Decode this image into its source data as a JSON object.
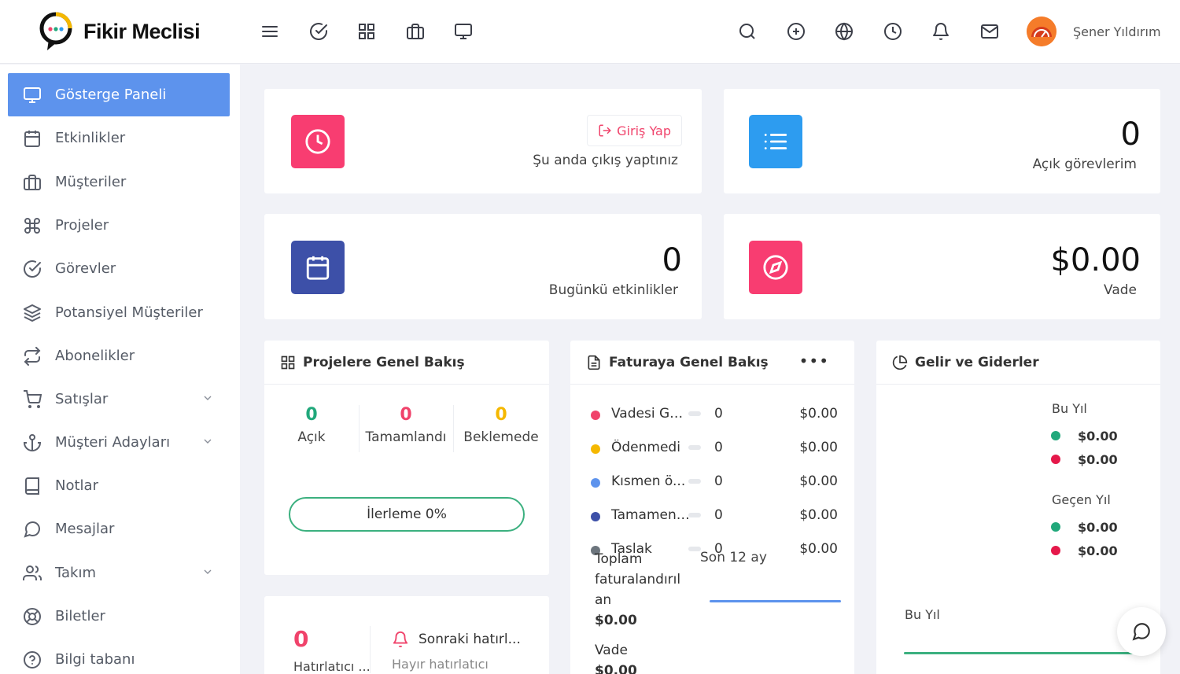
{
  "brand": {
    "name": "Fikir Meclisi"
  },
  "topbar": {
    "left_icons": [
      "menu-icon",
      "check-circle-icon",
      "grid-icon",
      "briefcase-icon",
      "monitor-icon"
    ],
    "right_icons": [
      "search-icon",
      "plus-circle-icon",
      "globe-icon",
      "clock-icon",
      "bell-icon",
      "mail-icon"
    ],
    "user_name": "Şener Yıldırım"
  },
  "sidebar": {
    "items": [
      {
        "label": "Gösterge Paneli",
        "icon": "monitor-icon",
        "active": true
      },
      {
        "label": "Etkinlikler",
        "icon": "calendar-icon"
      },
      {
        "label": "Müşteriler",
        "icon": "briefcase-icon"
      },
      {
        "label": "Projeler",
        "icon": "command-icon"
      },
      {
        "label": "Görevler",
        "icon": "check-circle-icon"
      },
      {
        "label": "Potansiyel Müşteriler",
        "icon": "layers-icon"
      },
      {
        "label": "Abonelikler",
        "icon": "repeat-icon"
      },
      {
        "label": "Satışlar",
        "icon": "cart-icon",
        "has_submenu": true
      },
      {
        "label": "Müşteri Adayları",
        "icon": "anchor-icon",
        "has_submenu": true
      },
      {
        "label": "Notlar",
        "icon": "book-icon"
      },
      {
        "label": "Mesajlar",
        "icon": "message-icon"
      },
      {
        "label": "Takım",
        "icon": "users-icon",
        "has_submenu": true
      },
      {
        "label": "Biletler",
        "icon": "lifebuoy-icon"
      },
      {
        "label": "Bilgi tabanı",
        "icon": "help-circle-icon"
      }
    ]
  },
  "widgets": {
    "clock": {
      "button_label": "Giriş Yap",
      "status_text": "Şu anda çıkış yaptınız"
    },
    "tasks": {
      "value": "0",
      "label": "Açık görevlerim"
    },
    "events": {
      "value": "0",
      "label": "Bugünkü etkinlikler"
    },
    "due": {
      "value": "$0.00",
      "label": "Vade"
    }
  },
  "projects_overview": {
    "title": "Projelere Genel Bakış",
    "stats": [
      {
        "value": "0",
        "label": "Açık",
        "color": "#21a87b"
      },
      {
        "value": "0",
        "label": "Tamamlandı",
        "color": "#f0436b"
      },
      {
        "value": "0",
        "label": "Beklemede",
        "color": "#f5b800"
      }
    ],
    "progress_label": "İlerleme 0%",
    "progress": 0
  },
  "invoice_overview": {
    "title": "Faturaya Genel Bakış",
    "rows": [
      {
        "label": "Vadesi Ge...",
        "count": "0",
        "amount": "$0.00",
        "color": "#f0436b"
      },
      {
        "label": "Ödenmedi",
        "count": "0",
        "amount": "$0.00",
        "color": "#f5b800"
      },
      {
        "label": "Kısmen ö...",
        "count": "0",
        "amount": "$0.00",
        "color": "#5d93ed"
      },
      {
        "label": "Tamamen ...",
        "count": "0",
        "amount": "$0.00",
        "color": "#3d50a8"
      },
      {
        "label": "Taslak",
        "count": "0",
        "amount": "$0.00",
        "color": "#6c757d"
      }
    ],
    "total_label_1": "Toplam",
    "total_label_2": "faturalandırıl",
    "total_label_3": "an",
    "total_value": "$0.00",
    "period_label": "Son 12 ay",
    "due_label": "Vade",
    "due_value": "$0.00"
  },
  "income_expense": {
    "title": "Gelir ve Giderler",
    "this_year_label": "Bu Yıl",
    "this_year_income": "$0.00",
    "this_year_expense": "$0.00",
    "last_year_label": "Geçen Yıl",
    "last_year_income": "$0.00",
    "last_year_expense": "$0.00",
    "chart_label": "Bu Yıl",
    "income_color": "#21a87b",
    "expense_color": "#e5184a"
  },
  "reminders": {
    "count": "0",
    "count_label": "Hatırlatıcı ...",
    "next_label": "Sonraki hatırl...",
    "none_label": "Hayır hatırlatıcı"
  },
  "colors": {
    "accent": "#5d93ed",
    "pink": "#f83d71",
    "blue": "#2d9cf0",
    "indigo": "#3d50a8"
  }
}
